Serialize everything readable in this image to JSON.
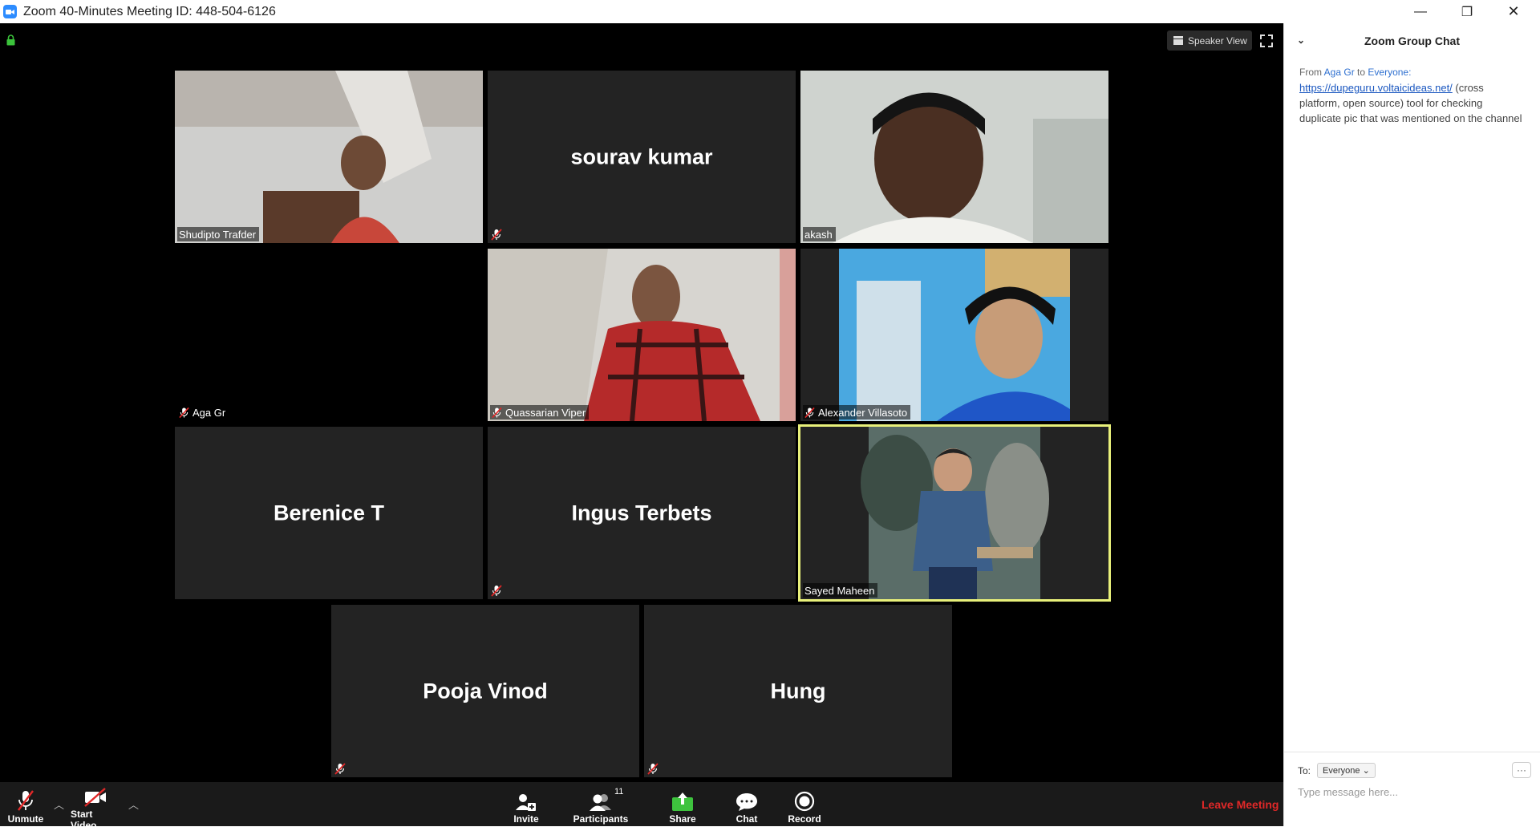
{
  "window": {
    "title": "Zoom 40-Minutes Meeting ID: 448-504-6126",
    "minimize_glyph": "—",
    "restore_glyph": "❐",
    "close_glyph": "✕"
  },
  "view_button": {
    "label": "Speaker View"
  },
  "tiles": [
    {
      "name": "Shudipto Trafder",
      "display": "video",
      "muted": false
    },
    {
      "name": "sourav kumar",
      "display": "name",
      "muted": true
    },
    {
      "name": "akash",
      "display": "video",
      "muted": false
    },
    {
      "name": "Aga Gr",
      "display": "blank",
      "muted": true
    },
    {
      "name": "Quassarian Viper",
      "display": "video",
      "muted": true
    },
    {
      "name": "Alexander Villasoto",
      "display": "video",
      "muted": true
    },
    {
      "name": "Berenice T",
      "display": "name",
      "muted": false
    },
    {
      "name": "Ingus Terbets",
      "display": "name",
      "muted": true
    },
    {
      "name": "Sayed Maheen",
      "display": "video",
      "muted": false,
      "active_speaker": true
    },
    {
      "name": "Pooja Vinod",
      "display": "name",
      "muted": true
    },
    {
      "name": "Hung",
      "display": "name",
      "muted": true
    }
  ],
  "toolbar": {
    "unmute": "Unmute",
    "start_video": "Start Video",
    "invite": "Invite",
    "participants": "Participants",
    "participants_count": "11",
    "share": "Share",
    "chat": "Chat",
    "record": "Record",
    "leave": "Leave Meeting"
  },
  "chat": {
    "title": "Zoom Group Chat",
    "message": {
      "from_prefix": "From",
      "sender": "Aga Gr",
      "to_word": "to",
      "recipient": "Everyone:",
      "link": "https://dupeguru.voltaicideas.net/",
      "text": " (cross platform, open source) tool for checking duplicate pic that was mentioned on the channel"
    },
    "to_label": "To:",
    "to_value": "Everyone",
    "more": "···",
    "placeholder": "Type message here..."
  },
  "colors": {
    "active_speaker_border": "#e8f07a",
    "leave": "#e02828",
    "share_green": "#3ec33e",
    "link_blue": "#1a57c0"
  }
}
